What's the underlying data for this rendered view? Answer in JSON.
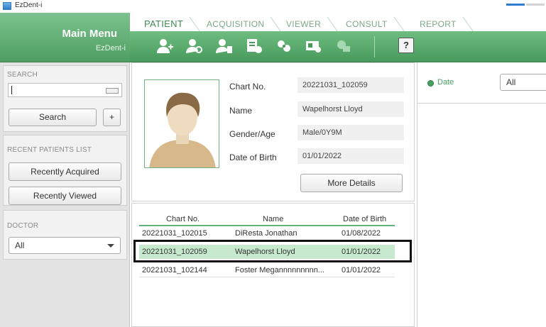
{
  "window": {
    "title": "EzDent-i"
  },
  "main_menu": {
    "title": "Main Menu",
    "subtitle": "EzDent-i"
  },
  "tabs": [
    {
      "label": "PATIENT",
      "active": true
    },
    {
      "label": "ACQUISITION",
      "active": false
    },
    {
      "label": "VIEWER",
      "active": false
    },
    {
      "label": "CONSULT",
      "active": false
    },
    {
      "label": "REPORT",
      "active": false
    }
  ],
  "toolbar": {
    "icons": [
      "add-patient-icon",
      "search-patient-icon",
      "delete-patient-icon",
      "export-icon",
      "transfer-icon",
      "id-card-icon",
      "merge-icon",
      "help-icon"
    ],
    "help_label": "?"
  },
  "sidebar": {
    "search": {
      "title": "SEARCH",
      "value": "",
      "button_label": "Search",
      "plus_label": "+"
    },
    "recent": {
      "title": "RECENT PATIENTS LIST",
      "acquired_label": "Recently Acquired",
      "viewed_label": "Recently Viewed"
    },
    "doctor": {
      "title": "DOCTOR",
      "selected": "All"
    }
  },
  "patient": {
    "chart_label": "Chart No.",
    "chart_value": "20221031_102059",
    "name_label": "Name",
    "name_value": "Wapelhorst Lloyd",
    "gender_label": "Gender/Age",
    "gender_value": "Male/0Y9M",
    "dob_label": "Date of Birth",
    "dob_value": "01/01/2022",
    "more_label": "More Details"
  },
  "patient_list": {
    "headers": [
      "Chart No.",
      "Name",
      "Date of Birth"
    ],
    "rows": [
      {
        "chart": "20221031_102015",
        "name": "DiResta Jonathan",
        "dob": "01/08/2022",
        "selected": false
      },
      {
        "chart": "20221031_102059",
        "name": "Wapelhorst Lloyd",
        "dob": "01/01/2022",
        "selected": true
      },
      {
        "chart": "20221031_102144",
        "name": "Foster Megannnnnnnnn...",
        "dob": "01/01/2022",
        "selected": false
      }
    ]
  },
  "filter": {
    "date_label": "Date",
    "date_value": "All"
  },
  "colors": {
    "accent": "#4f9e62",
    "selected_row": "#c7eace"
  }
}
